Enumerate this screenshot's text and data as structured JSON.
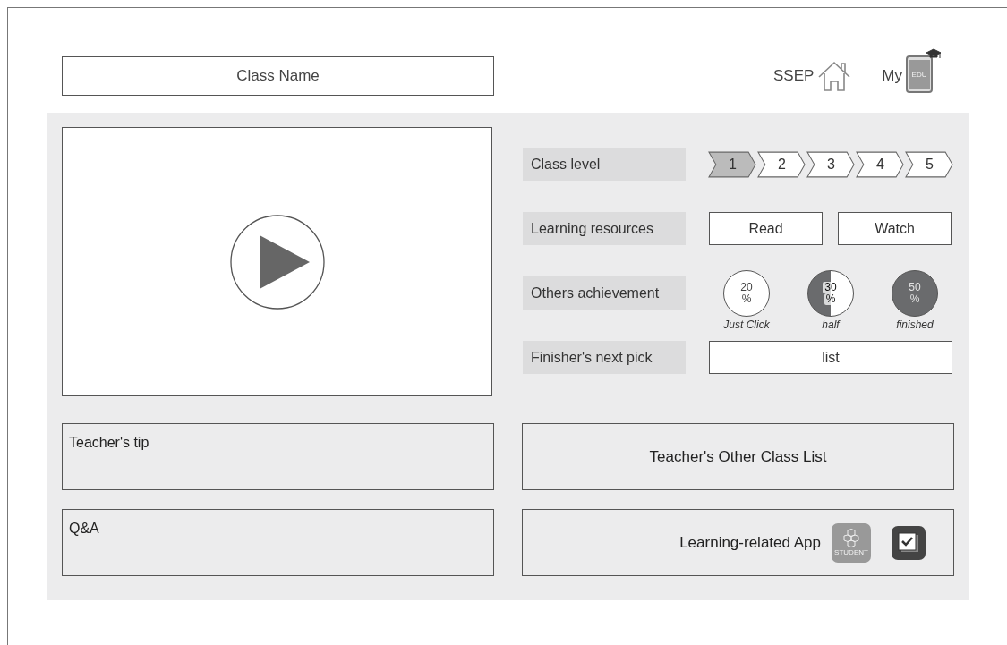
{
  "header": {
    "class_name": "Class Name",
    "ssep_label": "SSEP",
    "my_label": "My",
    "tablet_label": "EDU"
  },
  "info": {
    "class_level": {
      "label": "Class level",
      "steps": [
        {
          "label": "1",
          "selected": true
        },
        {
          "label": "2",
          "selected": false
        },
        {
          "label": "3",
          "selected": false
        },
        {
          "label": "4",
          "selected": false
        },
        {
          "label": "5",
          "selected": false
        }
      ]
    },
    "learning_resources": {
      "label": "Learning resources",
      "buttons": [
        "Read",
        "Watch"
      ]
    },
    "others_achievement": {
      "label": "Others achievement",
      "items": [
        {
          "value": "20",
          "unit": "%",
          "caption": "Just Click",
          "kind": "empty"
        },
        {
          "value": "30",
          "unit": "%",
          "caption": "half",
          "kind": "half"
        },
        {
          "value": "50",
          "unit": "%",
          "caption": "finished",
          "kind": "full"
        }
      ]
    },
    "finishers_next_pick": {
      "label": "Finisher's next pick",
      "button": "list"
    }
  },
  "teachers_tip": "Teacher's tip",
  "qa": "Q&A",
  "other_class_list": "Teacher's Other Class List",
  "apps": {
    "label": "Learning-related App",
    "student_app_label": "STUDENT"
  }
}
